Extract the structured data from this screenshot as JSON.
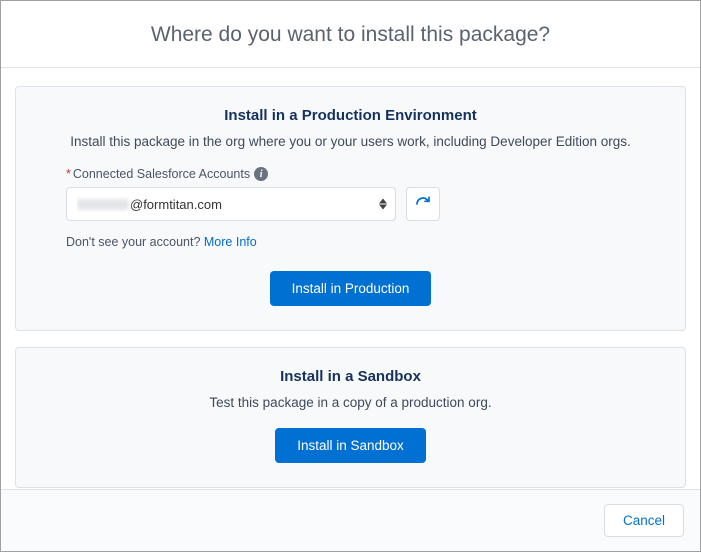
{
  "header": {
    "title": "Where do you want to install this package?"
  },
  "production": {
    "title": "Install in a Production Environment",
    "description": "Install this package in the org where you or your users work, including Developer Edition orgs.",
    "field_required_mark": "*",
    "field_label": "Connected Salesforce Accounts",
    "selected_account_suffix": "@formtitan.com",
    "hint_text": "Don't see your account? ",
    "hint_link": "More Info",
    "button": "Install in Production"
  },
  "sandbox": {
    "title": "Install in a Sandbox",
    "description": "Test this package in a copy of a production org.",
    "button": "Install in Sandbox"
  },
  "footer": {
    "cancel": "Cancel"
  }
}
